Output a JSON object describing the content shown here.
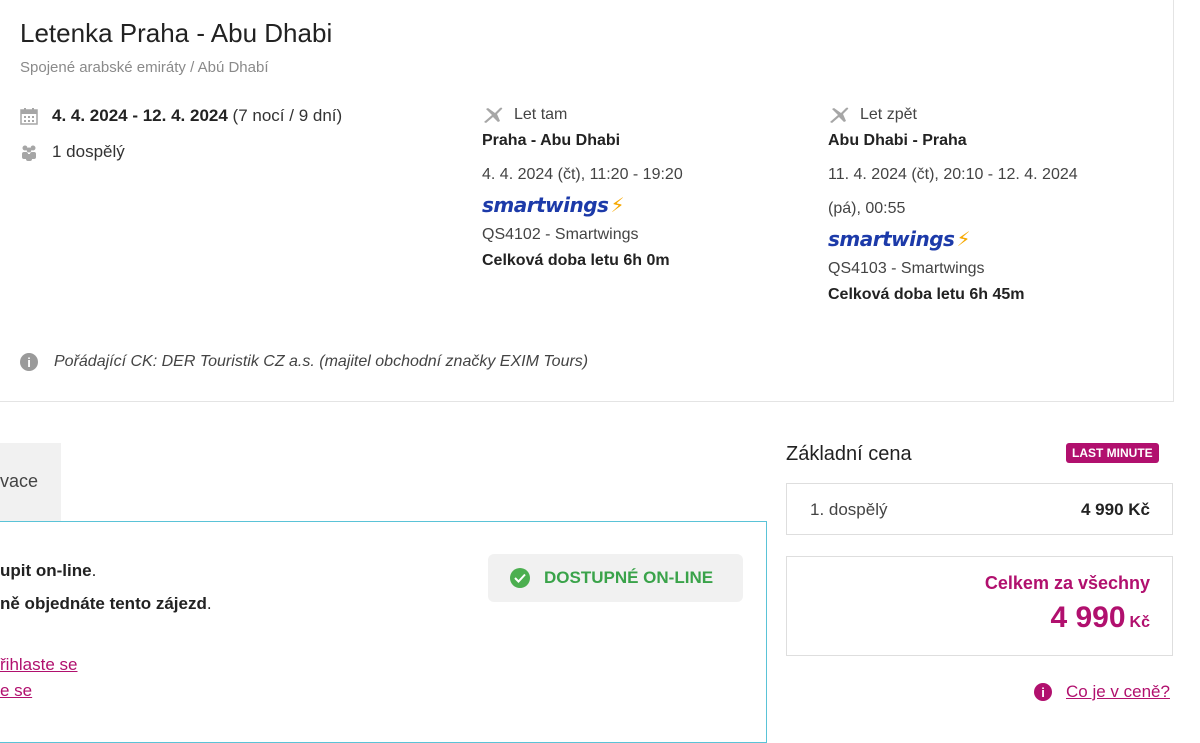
{
  "header": {
    "title": "Letenka Praha - Abu Dhabi",
    "subtitle": "Spojené arabské emiráty / Abú Dhabí"
  },
  "trip": {
    "dates": "4. 4. 2024 - 12. 4. 2024",
    "duration": "(7 nocí / 9 dní)",
    "travelers": "1 dospělý"
  },
  "outbound": {
    "label": "Let tam",
    "route": "Praha - Abu Dhabi",
    "time": "4. 4. 2024 (čt), 11:20 - 19:20",
    "airline_logo": "smartwings",
    "flight": "QS4102 - Smartwings",
    "total": "Celková doba letu 6h 0m"
  },
  "return": {
    "label": "Let zpět",
    "route": "Abu Dhabi - Praha",
    "time_line1": "11. 4. 2024 (čt), 20:10 - 12. 4. 2024",
    "time_line2": "(pá), 00:55",
    "airline_logo": "smartwings",
    "flight": "QS4103 - Smartwings",
    "total": "Celková doba letu 6h 45m"
  },
  "organizer": "Pořádající CK: DER Touristik CZ a.s. (majitel obchodní značky EXIM Tours)",
  "tab": {
    "label": "vace"
  },
  "panel": {
    "line1": "upit on-line",
    "line1_end": ".",
    "line2": "ně objednáte tento zájezd",
    "line2_end": ".",
    "link1": "řihlaste se",
    "link2": "e se",
    "online_badge": "DOSTUPNÉ ON-LINE"
  },
  "pricing": {
    "title": "Základní cena",
    "badge": "LAST MINUTE",
    "rows": [
      {
        "label": "1. dospělý",
        "value": "4 990 Kč"
      }
    ],
    "total_label": "Celkem za všechny",
    "total_amount": "4 990",
    "total_currency": "Kč",
    "help_link": "Co je v ceně?"
  },
  "colors": {
    "accent": "#b1106e",
    "success": "#3aa34a",
    "panel_border": "#5ac3d7"
  }
}
